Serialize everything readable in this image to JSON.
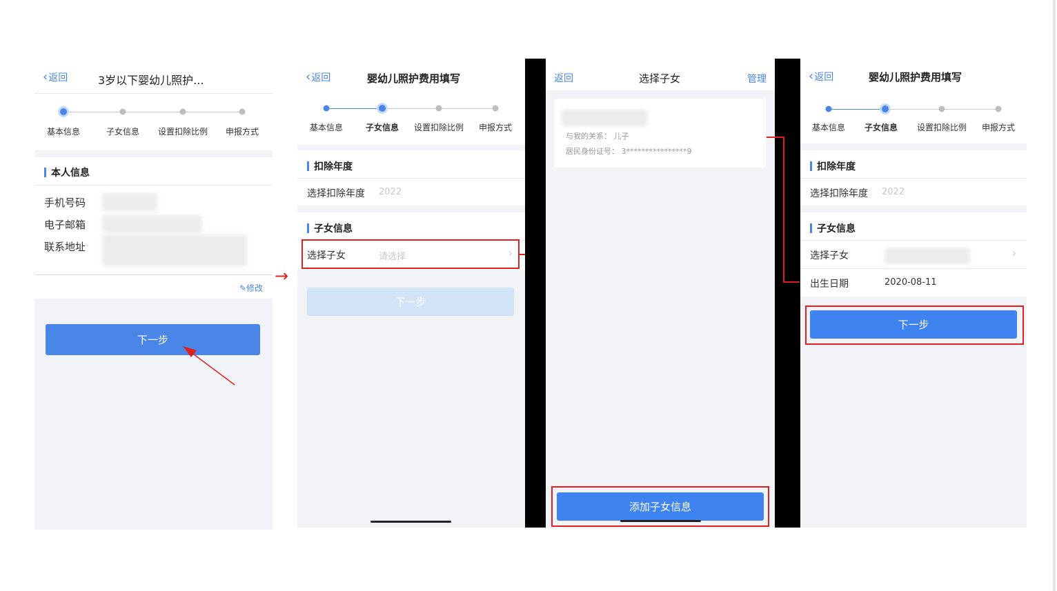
{
  "panel1": {
    "back": "返回",
    "title": "3岁以下婴幼儿照护...",
    "steps": [
      "基本信息",
      "子女信息",
      "设置扣除比例",
      "申报方式"
    ],
    "section_title": "本人信息",
    "fields": [
      "手机号码",
      "电子邮箱",
      "联系地址"
    ],
    "edit": "修改",
    "next": "下一步"
  },
  "panel2": {
    "back": "返回",
    "title": "婴幼儿照护费用填写",
    "steps": [
      "基本信息",
      "子女信息",
      "设置扣除比例",
      "申报方式"
    ],
    "year_section": "扣除年度",
    "year_label": "选择扣除年度",
    "year_value": "2022",
    "child_section": "子女信息",
    "child_label": "选择子女",
    "child_placeholder": "请选择",
    "next": "下一步"
  },
  "panel3": {
    "back": "返回",
    "title": "选择子女",
    "manage": "管理",
    "relation": "与我的关系：  儿子",
    "id_number": "居民身份证号：  3****************9",
    "add": "添加子女信息"
  },
  "panel4": {
    "back": "返回",
    "title": "婴幼儿照护费用填写",
    "steps": [
      "基本信息",
      "子女信息",
      "设置扣除比例",
      "申报方式"
    ],
    "year_section": "扣除年度",
    "year_label": "选择扣除年度",
    "year_value": "2022",
    "child_section": "子女信息",
    "child_label": "选择子女",
    "birth_label": "出生日期",
    "birth_value": "2020-08-11",
    "next": "下一步"
  },
  "colors": {
    "accent": "#4a86e8",
    "button": "#3f83f0",
    "highlight": "#e02020"
  }
}
